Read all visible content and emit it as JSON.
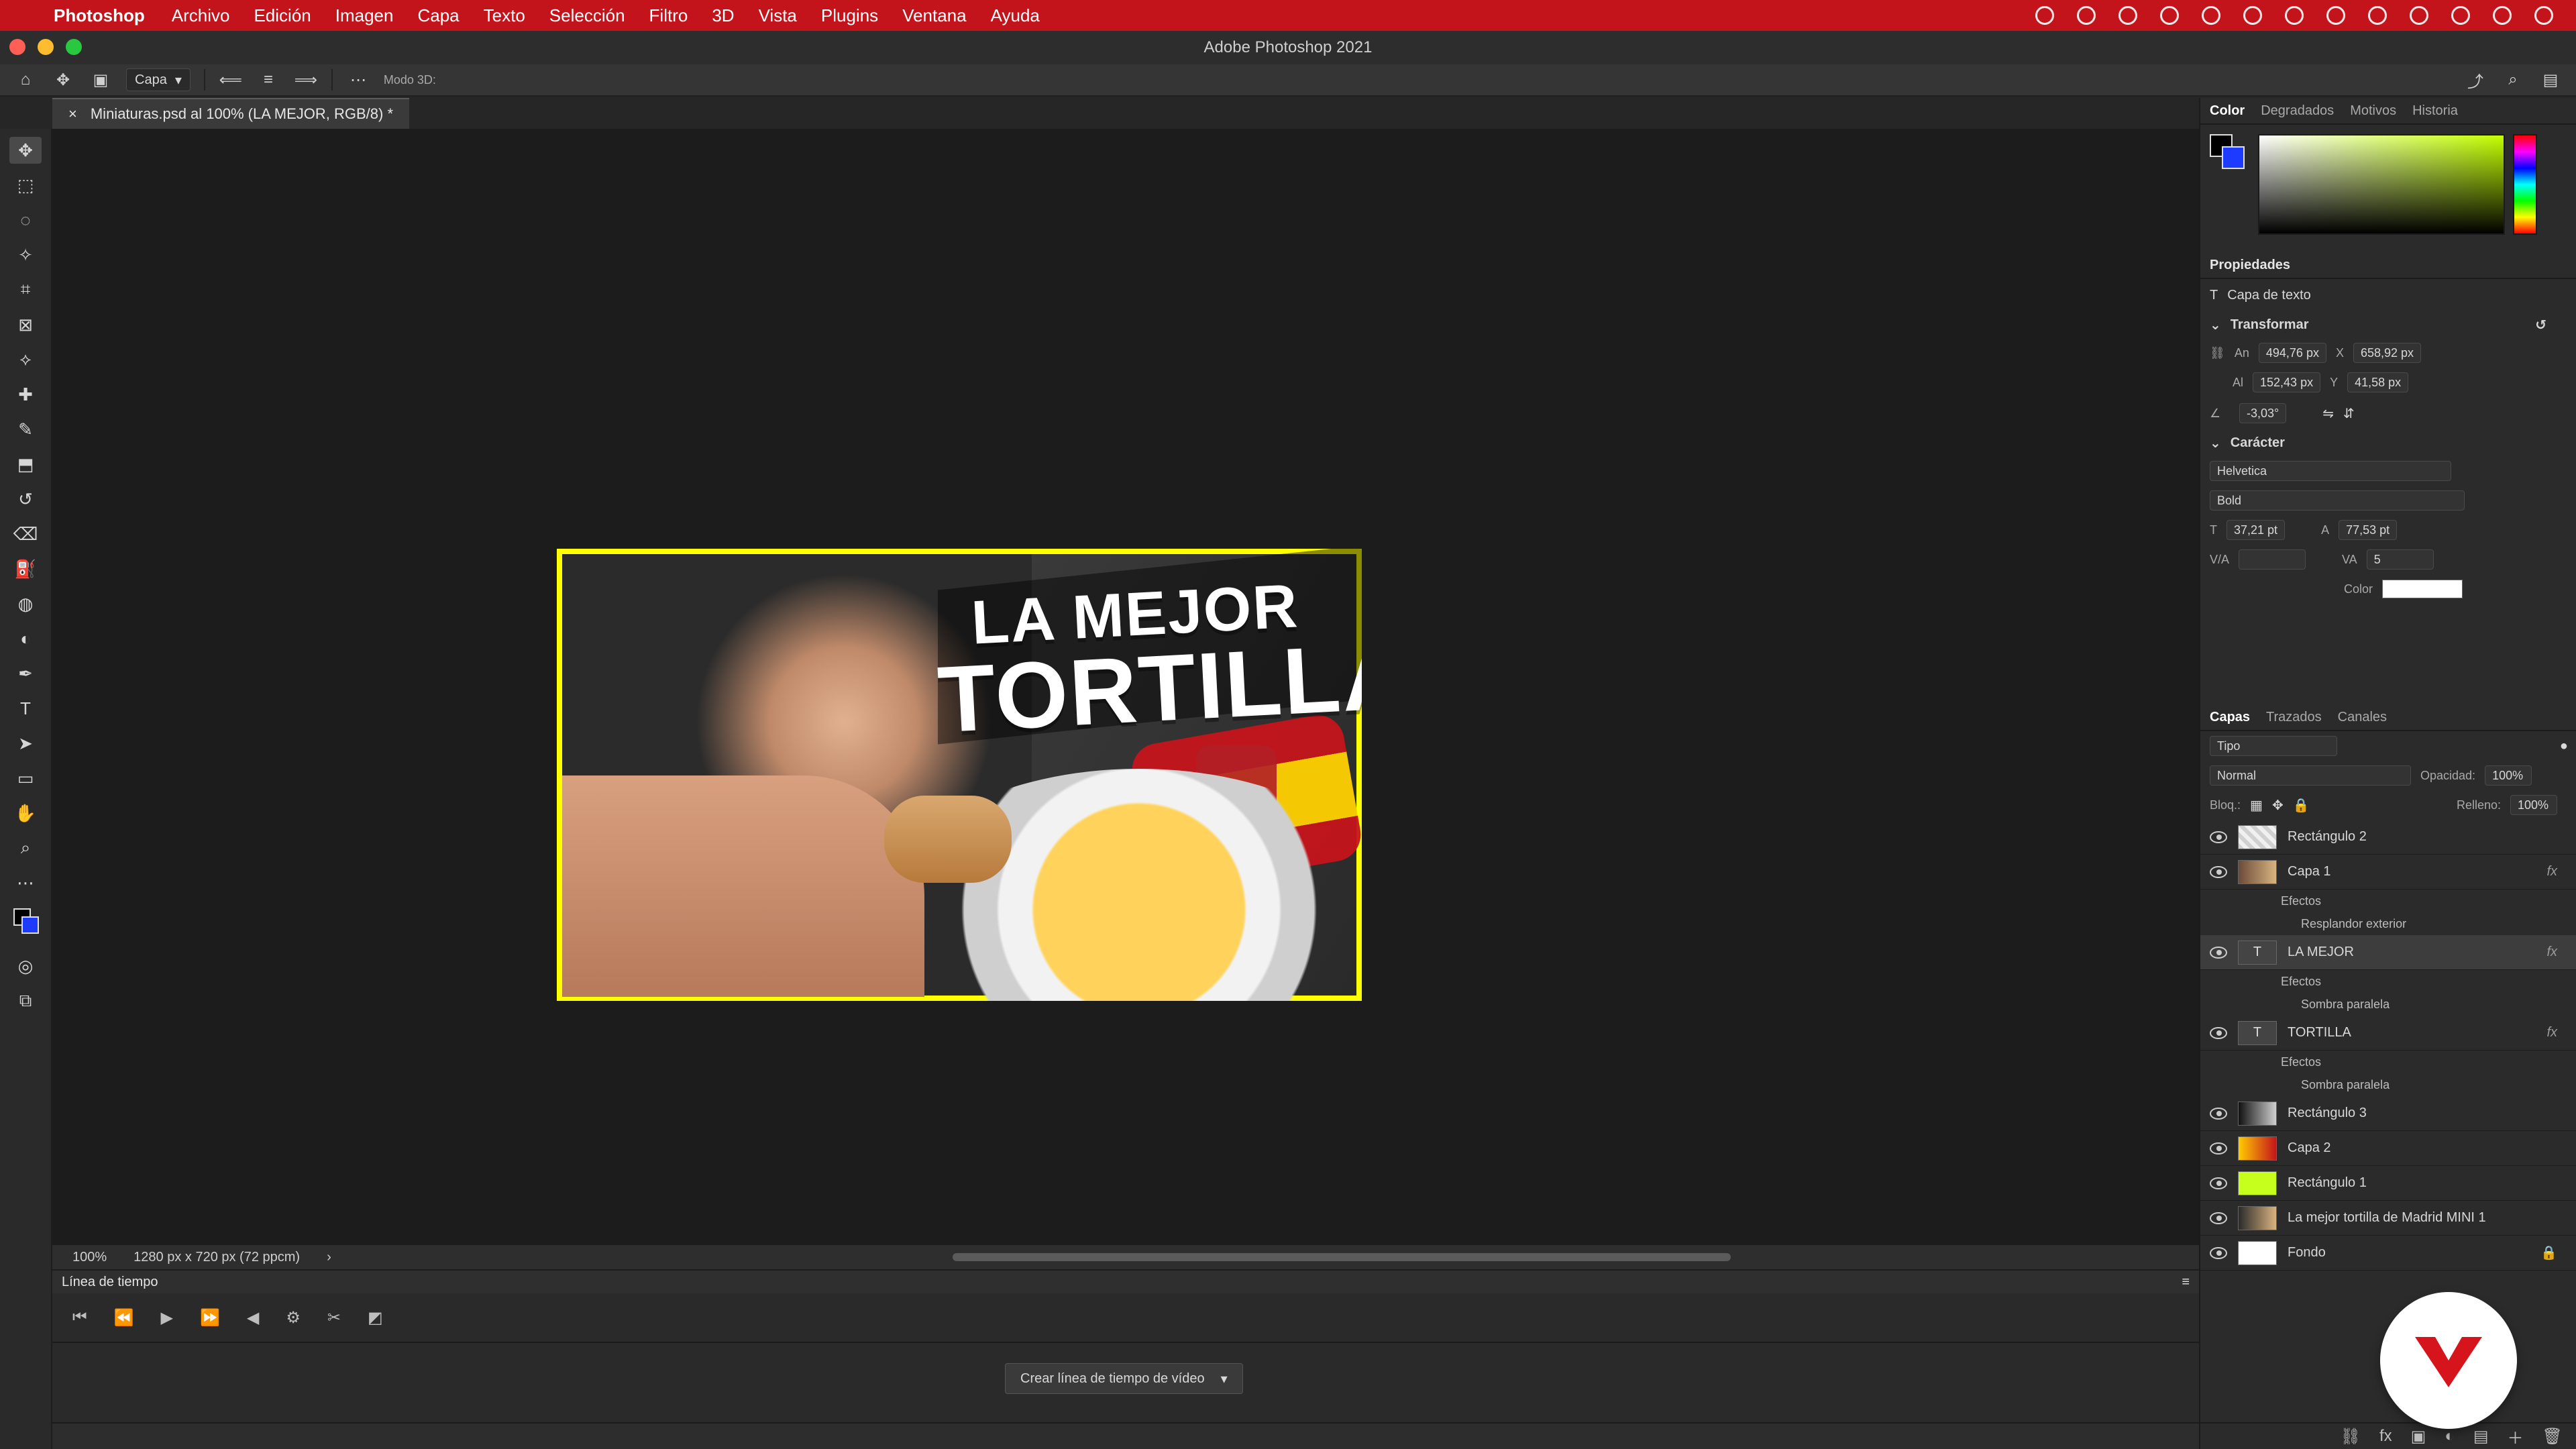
{
  "menubar": {
    "apple": "",
    "app": "Photoshop",
    "items": [
      "Archivo",
      "Edición",
      "Imagen",
      "Capa",
      "Texto",
      "Selección",
      "Filtro",
      "3D",
      "Vista",
      "Plugins",
      "Ventana",
      "Ayuda"
    ]
  },
  "window": {
    "title": "Adobe Photoshop 2021"
  },
  "options": {
    "layer_select": "Capa",
    "mode3d": "Modo 3D:"
  },
  "document_tab": {
    "label": "Miniaturas.psd al 100% (LA MEJOR, RGB/8) *"
  },
  "status": {
    "zoom": "100%",
    "size": "1280 px x 720 px (72 ppcm)"
  },
  "canvas_text": {
    "line1": "LA MEJOR",
    "line2": "TORTILLA"
  },
  "timeline": {
    "title": "Línea de tiempo",
    "button": "Crear línea de tiempo de vídeo"
  },
  "panels": {
    "color_tabs": [
      "Color",
      "Degradados",
      "Motivos",
      "Historia"
    ],
    "properties_title": "Propiedades",
    "layer_type": "Capa de texto",
    "transform_title": "Transformar",
    "width_label": "An",
    "width_value": "494,76 px",
    "height_label": "Al",
    "height_value": "152,43 px",
    "x_label": "X",
    "x_value": "658,92 px",
    "y_label": "Y",
    "y_value": "41,58 px",
    "angle_value": "-3,03°",
    "character_title": "Carácter",
    "font_family": "Helvetica",
    "font_style": "Bold",
    "font_size": "37,21 pt",
    "leading": "77,53 pt",
    "tracking_label": "V/A",
    "tracking_value": "5",
    "color_label": "Color",
    "layers_tabs": [
      "Capas",
      "Trazados",
      "Canales"
    ],
    "kind_filter": "Tipo",
    "blend_mode": "Normal",
    "opacity_label": "Opacidad:",
    "opacity_value": "100%",
    "lock_label": "Bloq.:",
    "fill_label": "Relleno:",
    "fill_value": "100%"
  },
  "layers": [
    {
      "name": "Rectángulo 2",
      "fx": false
    },
    {
      "name": "Capa 1",
      "fx": true,
      "effects": [
        "Efectos",
        "Resplandor exterior"
      ]
    },
    {
      "name": "LA MEJOR",
      "fx": true,
      "effects": [
        "Efectos",
        "Sombra paralela"
      ],
      "active": true
    },
    {
      "name": "TORTILLA",
      "fx": true,
      "effects": [
        "Efectos",
        "Sombra paralela"
      ]
    },
    {
      "name": "Rectángulo 3",
      "fx": false
    },
    {
      "name": "Capa 2",
      "fx": false
    },
    {
      "name": "Rectángulo 1",
      "fx": false
    },
    {
      "name": "La mejor tortilla de Madrid MINI 1",
      "fx": false
    },
    {
      "name": "Fondo",
      "fx": false,
      "locked": true
    }
  ]
}
